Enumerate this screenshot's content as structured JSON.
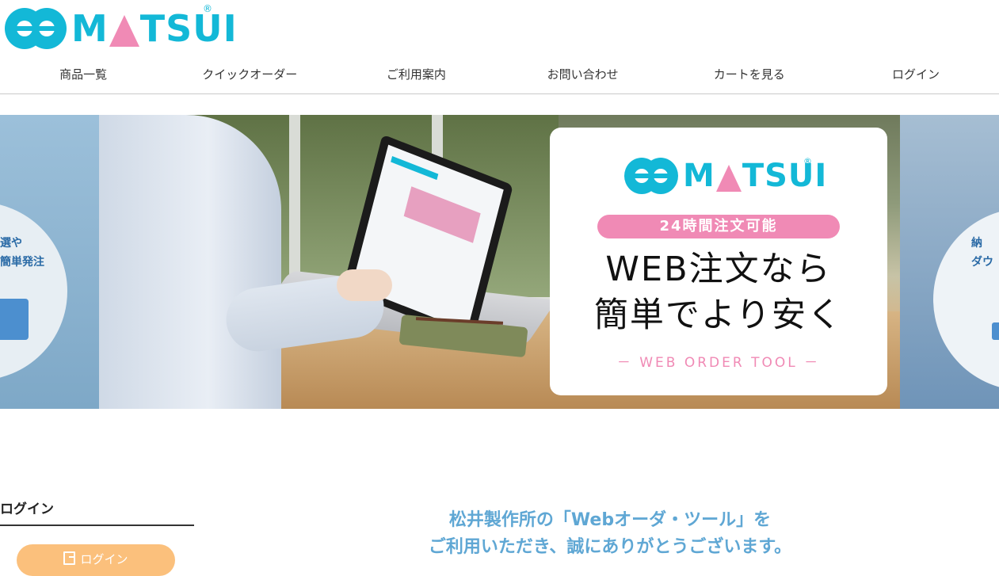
{
  "header": {
    "logo_text_left": "M",
    "logo_text_right": "TSUI",
    "logo_reg": "®"
  },
  "nav": {
    "items": [
      {
        "label": "商品一覧"
      },
      {
        "label": "クイックオーダー"
      },
      {
        "label": "ご利用案内"
      },
      {
        "label": "お問い合わせ"
      },
      {
        "label": "カートを見る"
      },
      {
        "label": "ログイン"
      }
    ]
  },
  "hero": {
    "left_slide_text": "選や\n簡単発注",
    "right_slide_text": "納\nダウ",
    "card": {
      "logo_text_left": "M",
      "logo_text_right": "TSUI",
      "logo_reg": "®",
      "pill": "24時間注文可能",
      "headline_line1": "WEB注文なら",
      "headline_line2": "簡単でより安く",
      "tool": "－ WEB ORDER TOOL －"
    }
  },
  "login": {
    "title": "ログイン",
    "button_label": "ログイン"
  },
  "welcome": {
    "line1": "松井製作所の「Webオーダ・ツール」を",
    "line2": "ご利用いただき、誠にありがとうございます。"
  },
  "colors": {
    "brand_cyan": "#13b8d7",
    "brand_pink": "#f08ab5",
    "login_button": "#fbc07c",
    "welcome_text": "#5fa7d4"
  }
}
